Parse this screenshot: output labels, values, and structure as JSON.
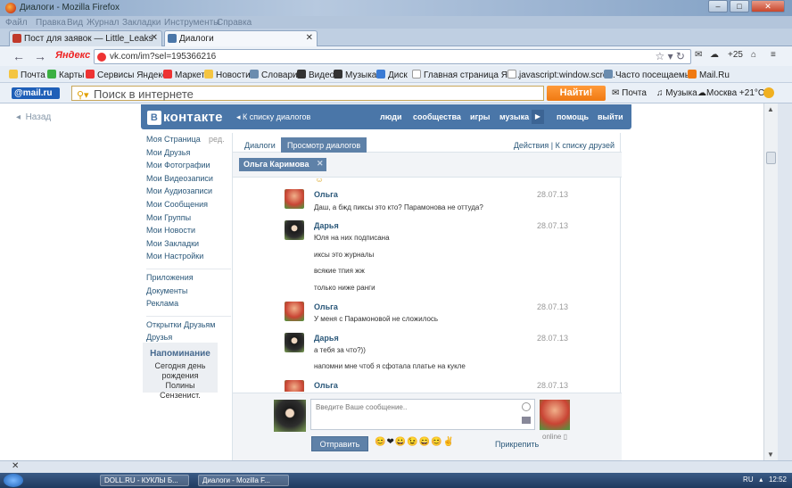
{
  "window": {
    "title": "Диалоги - Mozilla Firefox"
  },
  "menu": [
    "Файл",
    "Правка",
    "Вид",
    "Журнал",
    "Закладки",
    "Инструменты",
    "Справка"
  ],
  "tabs": [
    {
      "label": "Пост для заявок — Little_Leaks",
      "active": false
    },
    {
      "label": "Диалоги",
      "active": true
    }
  ],
  "nav": {
    "url": "vk.com/im?sel=195366216",
    "weather_icon": "cloud-icon",
    "counter": "+25"
  },
  "bookmarks": [
    "Почта",
    "Карты",
    "Сервисы Яндекса",
    "Маркет",
    "Новости",
    "Словари",
    "Видео",
    "Музыка",
    "Диск",
    "Главная страница Ян...",
    "javascript:window.scro...",
    "Часто посещаемые",
    "Mail.Ru"
  ],
  "mailru": {
    "logo": "@mail.ru",
    "placeholder": "Поиск в интернете",
    "find": "Найти!",
    "mail": "Почта",
    "music": "Музыка",
    "weather": "Москва +21°C"
  },
  "vk": {
    "back": "Назад",
    "logo": "контакте",
    "logo_letter": "В",
    "to_list": "К списку диалогов",
    "nav": [
      "люди",
      "сообщества",
      "игры",
      "музыка",
      "помощь",
      "выйти"
    ],
    "edit": "ред.",
    "menu_main": [
      "Моя Страница",
      "Мои Друзья",
      "Мои Фотографии",
      "Мои Видеозаписи",
      "Мои Аудиозаписи",
      "Мои Сообщения",
      "Мои Группы",
      "Мои Новости",
      "Мои Закладки",
      "Мои Настройки"
    ],
    "menu_apps": [
      "Приложения",
      "Документы",
      "Реклама"
    ],
    "menu_extra": [
      "Открытки Друзьям",
      "Друзья"
    ],
    "reminder": {
      "title": "Напоминание",
      "body": "Сегодня день рождения Полины Сензенист."
    },
    "dialog_tabs": [
      "Диалоги",
      "Просмотр диалогов"
    ],
    "actions": "Действия",
    "to_friends": "К списку друзей",
    "chip": "Ольга Каримова",
    "messages": [
      {
        "author": "Ольга",
        "date": "28.07.13",
        "avatar": "olga",
        "lines": [
          "Даш, а бжд пиксы это кто? Парамонова не оттуда?"
        ]
      },
      {
        "author": "Дарья",
        "date": "28.07.13",
        "avatar": "darya",
        "lines": [
          "Юля на них подписана",
          "иксы это журналы",
          "всякие тпия жж",
          "только ниже ранги"
        ]
      },
      {
        "author": "Ольга",
        "date": "28.07.13",
        "avatar": "olga",
        "lines": [
          "У меня с Парамоновой не сложилось"
        ]
      },
      {
        "author": "Дарья",
        "date": "28.07.13",
        "avatar": "darya",
        "lines": [
          "а тебя за что?))",
          "напомни мне чтоб я сфотала платье на кукле"
        ]
      },
      {
        "author": "Ольга",
        "date": "28.07.13",
        "avatar": "olga",
        "lines": []
      }
    ],
    "reply": {
      "placeholder": "Введите Ваше сообщение..",
      "send": "Отправить",
      "attach": "Прикрепить",
      "online": "online",
      "smiles": "😊❤😀😉😄😊✌"
    }
  },
  "taskbar": [
    "DOLL.RU - КУКЛЫ Б...",
    "Диалоги - Mozilla F..."
  ],
  "tray": {
    "lang": "RU",
    "time": "12:52"
  },
  "colors": {
    "vk_blue": "#4a76a8",
    "vk_link": "#2b587a",
    "find_orange": "#f07a12"
  }
}
